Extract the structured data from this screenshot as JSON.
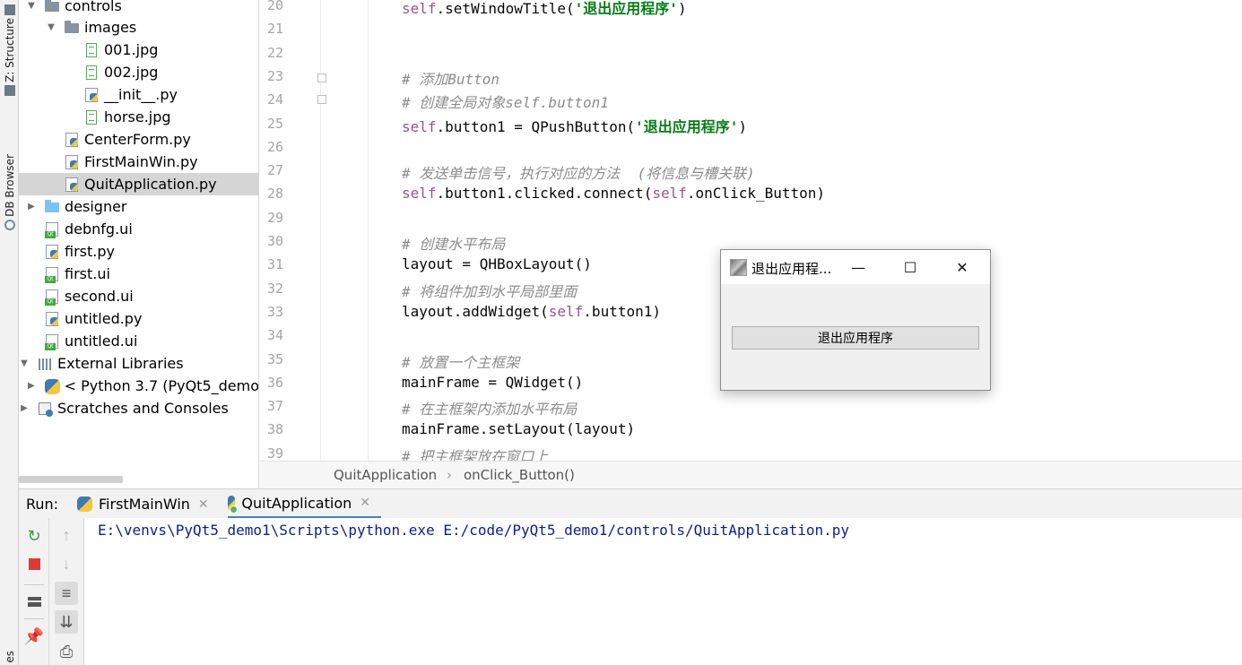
{
  "left_strip": {
    "structure_label": "Z: Structure",
    "db_browser_label": "DB Browser",
    "bottom_label": "es"
  },
  "project_tree": [
    {
      "label": "controls",
      "kind": "folder",
      "expanded": true
    },
    {
      "label": "images",
      "kind": "folder",
      "expanded": true
    },
    {
      "label": "001.jpg",
      "kind": "image"
    },
    {
      "label": "002.jpg",
      "kind": "image"
    },
    {
      "label": "__init__.py",
      "kind": "python"
    },
    {
      "label": "horse.jpg",
      "kind": "image"
    },
    {
      "label": "CenterForm.py",
      "kind": "python"
    },
    {
      "label": "FirstMainWin.py",
      "kind": "python"
    },
    {
      "label": "QuitApplication.py",
      "kind": "python",
      "selected": true
    },
    {
      "label": "designer",
      "kind": "folder",
      "expanded": false
    },
    {
      "label": "debnfg.ui",
      "kind": "qt-ui"
    },
    {
      "label": "first.py",
      "kind": "python"
    },
    {
      "label": "first.ui",
      "kind": "qt-ui"
    },
    {
      "label": "second.ui",
      "kind": "qt-ui"
    },
    {
      "label": "untitled.py",
      "kind": "python"
    },
    {
      "label": "untitled.ui",
      "kind": "qt-ui"
    },
    {
      "label": "External Libraries",
      "kind": "library",
      "expanded": true
    },
    {
      "label": "< Python 3.7 (PyQt5_demo",
      "kind": "python-sdk",
      "expanded": false
    },
    {
      "label": "Scratches and Consoles",
      "kind": "scratch",
      "expanded": false
    }
  ],
  "editor": {
    "lines": [
      {
        "num": "20",
        "parts": [
          {
            "t": "self",
            "c": "self"
          },
          {
            "t": ".setWindowTitle(",
            "c": "plain"
          },
          {
            "t": "'退出应用程序'",
            "c": "str"
          },
          {
            "t": ")",
            "c": "plain"
          }
        ]
      },
      {
        "num": "21",
        "parts": []
      },
      {
        "num": "22",
        "parts": []
      },
      {
        "num": "23",
        "parts": [
          {
            "t": "# 添加Button",
            "c": "cmt"
          }
        ]
      },
      {
        "num": "24",
        "parts": [
          {
            "t": "# 创建全局对象self.button1",
            "c": "cmt"
          }
        ]
      },
      {
        "num": "25",
        "parts": [
          {
            "t": "self",
            "c": "self"
          },
          {
            "t": ".button1 = QPushButton(",
            "c": "plain"
          },
          {
            "t": "'退出应用程序'",
            "c": "str"
          },
          {
            "t": ")",
            "c": "plain"
          }
        ]
      },
      {
        "num": "26",
        "parts": []
      },
      {
        "num": "27",
        "parts": [
          {
            "t": "# 发送单击信号，执行对应的方法  (将信息与槽关联)",
            "c": "cmt"
          }
        ]
      },
      {
        "num": "28",
        "parts": [
          {
            "t": "self",
            "c": "self"
          },
          {
            "t": ".button1.clicked.connect(",
            "c": "plain"
          },
          {
            "t": "self",
            "c": "self"
          },
          {
            "t": ".onClick_Button)",
            "c": "plain"
          }
        ]
      },
      {
        "num": "29",
        "parts": []
      },
      {
        "num": "30",
        "parts": [
          {
            "t": "# 创建水平布局",
            "c": "cmt"
          }
        ]
      },
      {
        "num": "31",
        "parts": [
          {
            "t": "layout = QHBoxLayout()",
            "c": "plain"
          }
        ]
      },
      {
        "num": "32",
        "parts": [
          {
            "t": "# 将组件加到水平局部里面",
            "c": "cmt"
          }
        ]
      },
      {
        "num": "33",
        "parts": [
          {
            "t": "layout.addWidget(",
            "c": "plain"
          },
          {
            "t": "self",
            "c": "self"
          },
          {
            "t": ".button1)",
            "c": "plain"
          }
        ]
      },
      {
        "num": "34",
        "parts": []
      },
      {
        "num": "35",
        "parts": [
          {
            "t": "# 放置一个主框架",
            "c": "cmt"
          }
        ]
      },
      {
        "num": "36",
        "parts": [
          {
            "t": "mainFrame = QWidget()",
            "c": "plain"
          }
        ]
      },
      {
        "num": "37",
        "parts": [
          {
            "t": "# 在主框架内添加水平布局",
            "c": "cmt"
          }
        ]
      },
      {
        "num": "38",
        "parts": [
          {
            "t": "mainFrame.setLayout(layout)",
            "c": "plain"
          }
        ]
      },
      {
        "num": "39",
        "parts": [
          {
            "t": "# 把主框架放在窗口上",
            "c": "cmt"
          }
        ]
      }
    ]
  },
  "breadcrumb": {
    "class_name": "QuitApplication",
    "separator": "›",
    "method_name": "onClick_Button()"
  },
  "run_panel": {
    "label": "Run:",
    "tabs": [
      {
        "label": "FirstMainWin",
        "active": false
      },
      {
        "label": "QuitApplication",
        "active": true
      }
    ],
    "console_output": "E:\\venvs\\PyQt5_demo1\\Scripts\\python.exe E:/code/PyQt5_demo1/controls/QuitApplication.py"
  },
  "app_window": {
    "title": "退出应用程...",
    "minimize_glyph": "—",
    "maximize_glyph": "☐",
    "close_glyph": "✕",
    "button_label": "退出应用程序"
  },
  "colors": {
    "self_keyword": "#94558d",
    "string": "#067d17",
    "comment": "#8c8c8c",
    "console_text": "#0c1e8c",
    "selection": "#d5d5d5",
    "active_tab_underline": "#4083c9"
  }
}
